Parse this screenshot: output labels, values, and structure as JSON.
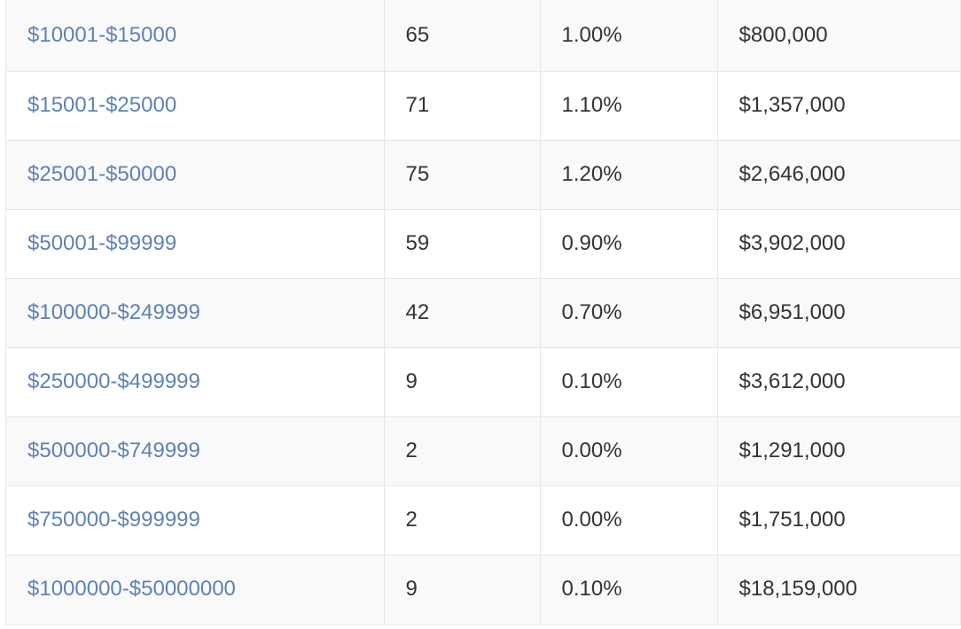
{
  "table": {
    "rows": [
      {
        "range": "$10001-$15000",
        "count": "65",
        "percent": "1.00%",
        "amount": "$800,000"
      },
      {
        "range": "$15001-$25000",
        "count": "71",
        "percent": "1.10%",
        "amount": "$1,357,000"
      },
      {
        "range": "$25001-$50000",
        "count": "75",
        "percent": "1.20%",
        "amount": "$2,646,000"
      },
      {
        "range": "$50001-$99999",
        "count": "59",
        "percent": "0.90%",
        "amount": "$3,902,000"
      },
      {
        "range": "$100000-$249999",
        "count": "42",
        "percent": "0.70%",
        "amount": "$6,951,000"
      },
      {
        "range": "$250000-$499999",
        "count": "9",
        "percent": "0.10%",
        "amount": "$3,612,000"
      },
      {
        "range": "$500000-$749999",
        "count": "2",
        "percent": "0.00%",
        "amount": "$1,291,000"
      },
      {
        "range": "$750000-$999999",
        "count": "2",
        "percent": "0.00%",
        "amount": "$1,751,000"
      },
      {
        "range": "$1000000-$50000000",
        "count": "9",
        "percent": "0.10%",
        "amount": "$18,159,000"
      }
    ]
  },
  "colors": {
    "link": "#5e82b4",
    "text": "#333333",
    "border": "#e6e6e6",
    "stripe": "#f9f9f9"
  }
}
